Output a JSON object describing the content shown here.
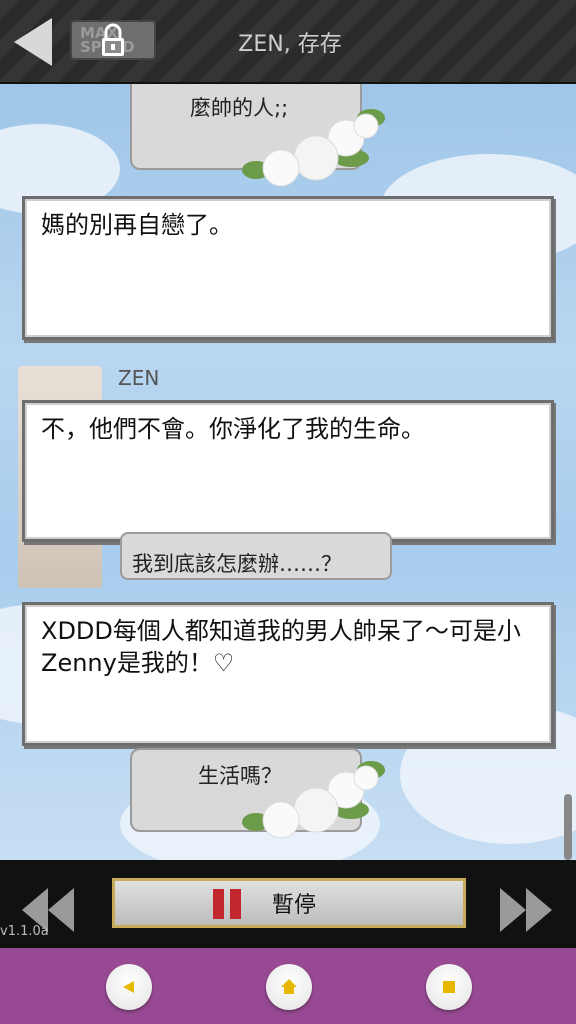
{
  "header": {
    "title": "ZEN, 存存",
    "lock_bg_text": "MAX SPEED"
  },
  "chat": {
    "gray_top_partial": "麼帥的人;;",
    "white_box_1": "媽的別再自戀了。",
    "sender_name": "ZEN",
    "white_box_2": "不，他們不會。你淨化了我的生命。",
    "gray_middle": "我到底該怎麼辦……？",
    "white_box_3": "XDDD每個人都知道我的男人帥呆了～可是小Zenny是我的！♡",
    "gray_bottom_partial": "生活嗎？"
  },
  "controls": {
    "pause_label": "暫停",
    "version": "v1.1.0a"
  },
  "nav": {
    "buttons": [
      "back-nav-icon",
      "home-icon",
      "stop-icon"
    ]
  },
  "colors": {
    "navbar": "#974a93",
    "accent_pause": "#c0282d",
    "sky": "#a9cdee"
  }
}
